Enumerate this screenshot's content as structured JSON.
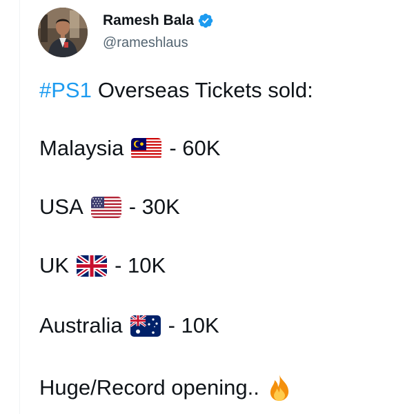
{
  "author": {
    "name": "Ramesh Bala",
    "handle": "@rameshlaus",
    "verified_icon": "verified-badge-icon",
    "avatar_icon": "profile-photo"
  },
  "tweet": {
    "hashtag": "#PS1",
    "headline": "Overseas Tickets sold:",
    "rows": [
      {
        "country": "Malaysia",
        "flag_icon": "malaysia-flag-icon",
        "value": "- 60K"
      },
      {
        "country": "USA",
        "flag_icon": "usa-flag-icon",
        "value": "- 30K"
      },
      {
        "country": "UK",
        "flag_icon": "uk-flag-icon",
        "value": "- 10K"
      },
      {
        "country": "Australia",
        "flag_icon": "australia-flag-icon",
        "value": "- 10K"
      }
    ],
    "closing": "Huge/Record opening..",
    "closing_icon": "fire-icon"
  },
  "colors": {
    "hashtag": "#1d9bf0",
    "verified": "#1d9bf0",
    "handle": "#536471",
    "text": "#0f1419"
  }
}
